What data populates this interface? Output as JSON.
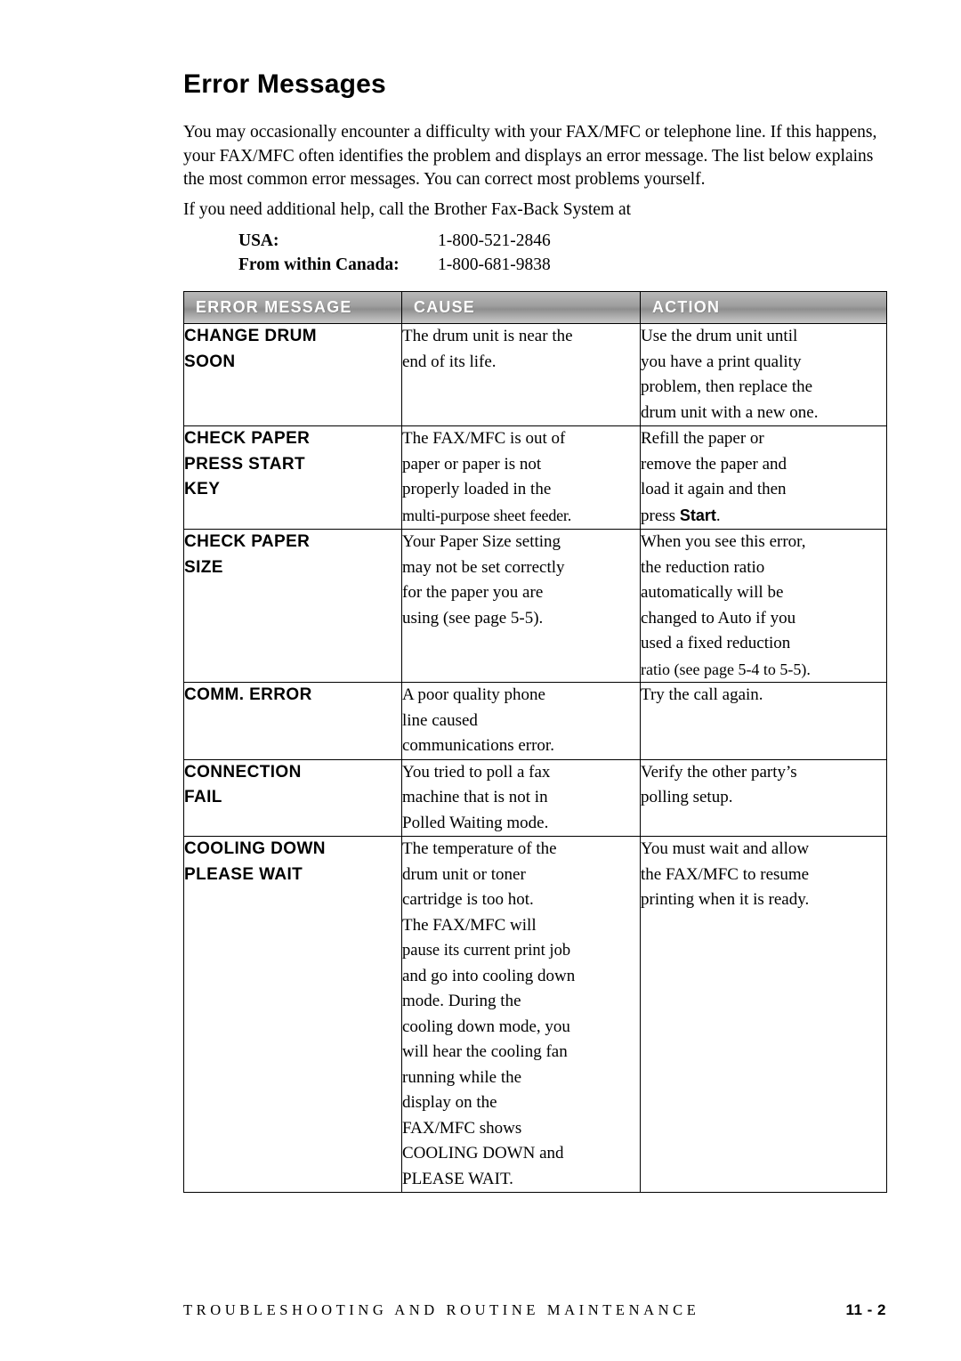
{
  "page": {
    "title": "Error Messages",
    "intro_lines": [
      "You may occasionally encounter a difficulty with your FAX/MFC or telephone",
      "line. If this happens, your FAX/MFC often identifies the problem and displays",
      "an error message. The list below explains the most common error messages.",
      "You can correct most problems yourself."
    ],
    "intro2": "If you need additional help, call the Brother Fax-Back System at",
    "contacts": [
      {
        "label": "USA:",
        "number": "1-800-521-2846"
      },
      {
        "label": "From within Canada:",
        "number": "1-800-681-9838"
      }
    ],
    "table": {
      "headers": [
        "ERROR MESSAGE",
        "CAUSE",
        "ACTION"
      ],
      "rows": [
        {
          "message": [
            "CHANGE DRUM",
            "SOON"
          ],
          "cause": [
            "The drum unit is near the",
            "end of its life."
          ],
          "action": [
            "Use the drum unit until",
            "you have a print quality",
            "problem, then replace the",
            "drum unit with a new one."
          ]
        },
        {
          "message": [
            "CHECK PAPER",
            "PRESS START",
            "KEY"
          ],
          "cause": [
            "The FAX/MFC is out of",
            "paper or paper is not",
            "properly loaded in the",
            "multi-purpose sheet feeder."
          ],
          "action": [
            "Refill the paper or",
            "remove the paper and",
            "load it again and then",
            "press Start."
          ],
          "action_bold_word": "Start"
        },
        {
          "message": [
            "CHECK PAPER",
            "SIZE"
          ],
          "cause": [
            "Your Paper Size setting",
            "may not be set correctly",
            "for the paper you are",
            "using (see page 5-5)."
          ],
          "action": [
            "When you see this error,",
            "the reduction ratio",
            "automatically will be",
            "changed to Auto if you",
            "used a fixed reduction",
            "ratio (see  page 5-4 to 5-5)."
          ]
        },
        {
          "message": [
            "COMM. ERROR"
          ],
          "cause": [
            "A poor quality phone",
            "line caused",
            "communications error."
          ],
          "action": [
            "Try the call again."
          ]
        },
        {
          "message": [
            "CONNECTION",
            "FAIL"
          ],
          "cause": [
            "You tried to poll a fax",
            "machine that is not in",
            "Polled Waiting mode."
          ],
          "action": [
            "Verify the other party’s",
            "polling setup."
          ]
        },
        {
          "message": [
            "COOLING DOWN",
            "PLEASE WAIT"
          ],
          "cause": [
            "The temperature of the",
            "drum unit or toner",
            "cartridge is too hot.",
            "The FAX/MFC will",
            "pause its current print job",
            "and go into cooling down",
            "mode.  During the",
            "cooling down mode, you",
            "will hear the cooling fan",
            "running  while the",
            "display on the",
            "FAX/MFC shows",
            "COOLING DOWN and",
            "PLEASE WAIT."
          ],
          "action": [
            "You must wait and allow",
            "the FAX/MFC to resume",
            "printing when it is ready."
          ]
        }
      ]
    },
    "footer": {
      "left": "TROUBLESHOOTING AND ROUTINE MAINTENANCE",
      "right": "11 - 2"
    }
  }
}
